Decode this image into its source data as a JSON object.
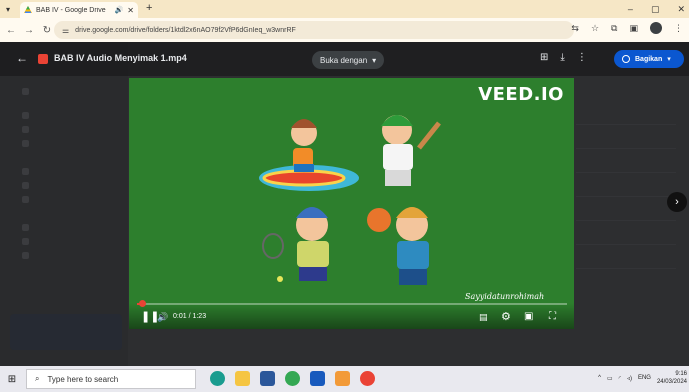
{
  "browser": {
    "tab_title": "BAB IV - Google Drive",
    "tab_audio_icon": "speaker-icon",
    "new_tab": "+",
    "url": "drive.google.com/drive/folders/1ktdl2x6nAO79f2VfP6dGnIeq_w3wnrRF",
    "window_controls": [
      "–",
      "▢",
      "✕"
    ]
  },
  "viewer": {
    "file_title": "BAB IV Audio Menyimak 1.mp4",
    "open_with": "Buka dengan",
    "share": "Bagikan"
  },
  "video": {
    "watermark": "VEED.IO",
    "signature": "Sayyidatunrohimah",
    "current_time": "0:01 / 1:23",
    "progress": 0.012,
    "colors": {
      "background": "#2d7f2d",
      "progress": "#ea4335"
    }
  },
  "taskbar": {
    "search_placeholder": "Type here to search",
    "lang": "ENG",
    "time": "9:16",
    "date": "24/03/2024"
  }
}
